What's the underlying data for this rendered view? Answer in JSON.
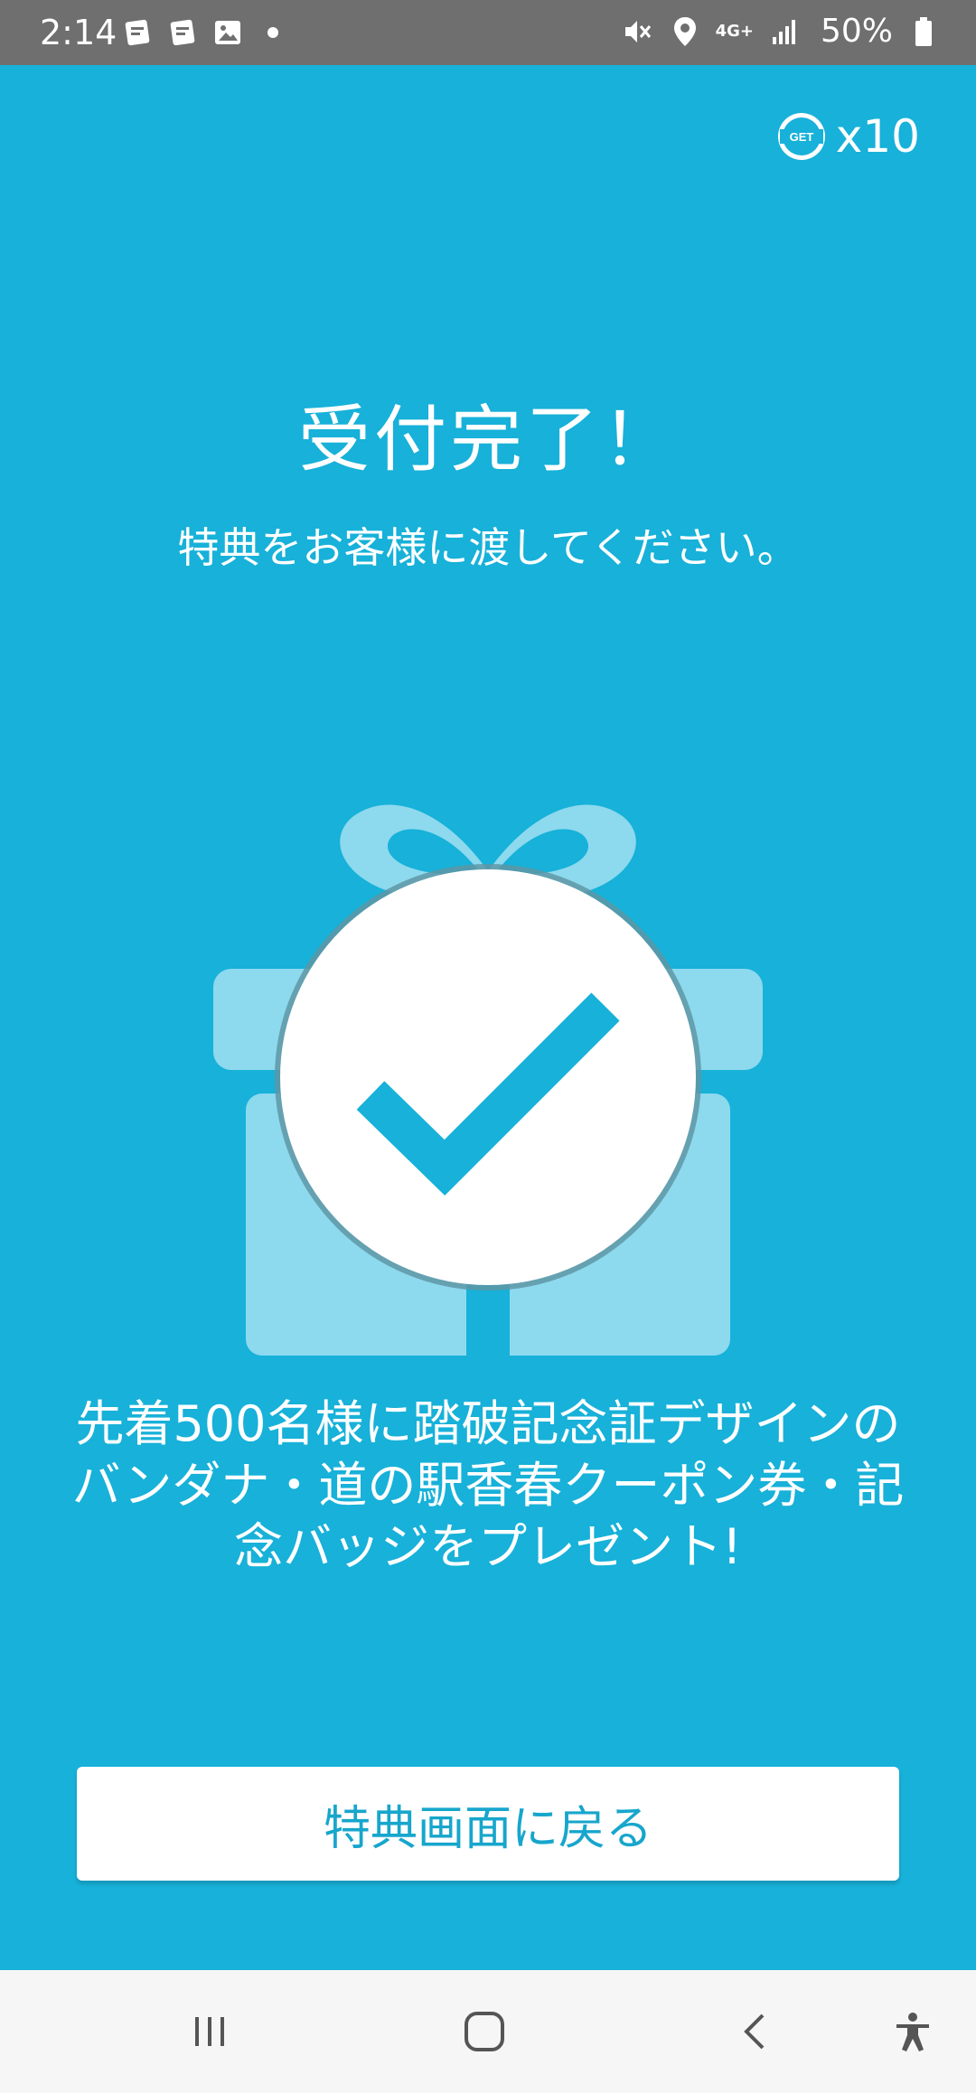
{
  "status_bar": {
    "time": "2:14",
    "network": "4G+",
    "battery": "50%"
  },
  "header": {
    "get_label": "GET",
    "get_count": "x10"
  },
  "content": {
    "title": "受付完了！",
    "subtitle": "特典をお客様に渡してください。",
    "description_lines": [
      "先着500名様に踏破記念証デザインの",
      "バンダナ・道の駅香春クーポン券・記",
      "念バッジをプレゼント!"
    ]
  },
  "actions": {
    "return_label": "特典画面に戻る"
  },
  "colors": {
    "background": "#17b1d9",
    "status_bar": "#6f6f6f",
    "gift_light": "#8dd9ee",
    "check": "#17b1d9"
  },
  "icons": [
    "notification-icon",
    "notification-icon",
    "gallery-icon",
    "mute-icon",
    "location-icon",
    "signal-icon",
    "battery-icon",
    "gift-icon",
    "checkmark-icon",
    "recent-apps-icon",
    "home-icon",
    "back-icon",
    "accessibility-icon"
  ]
}
